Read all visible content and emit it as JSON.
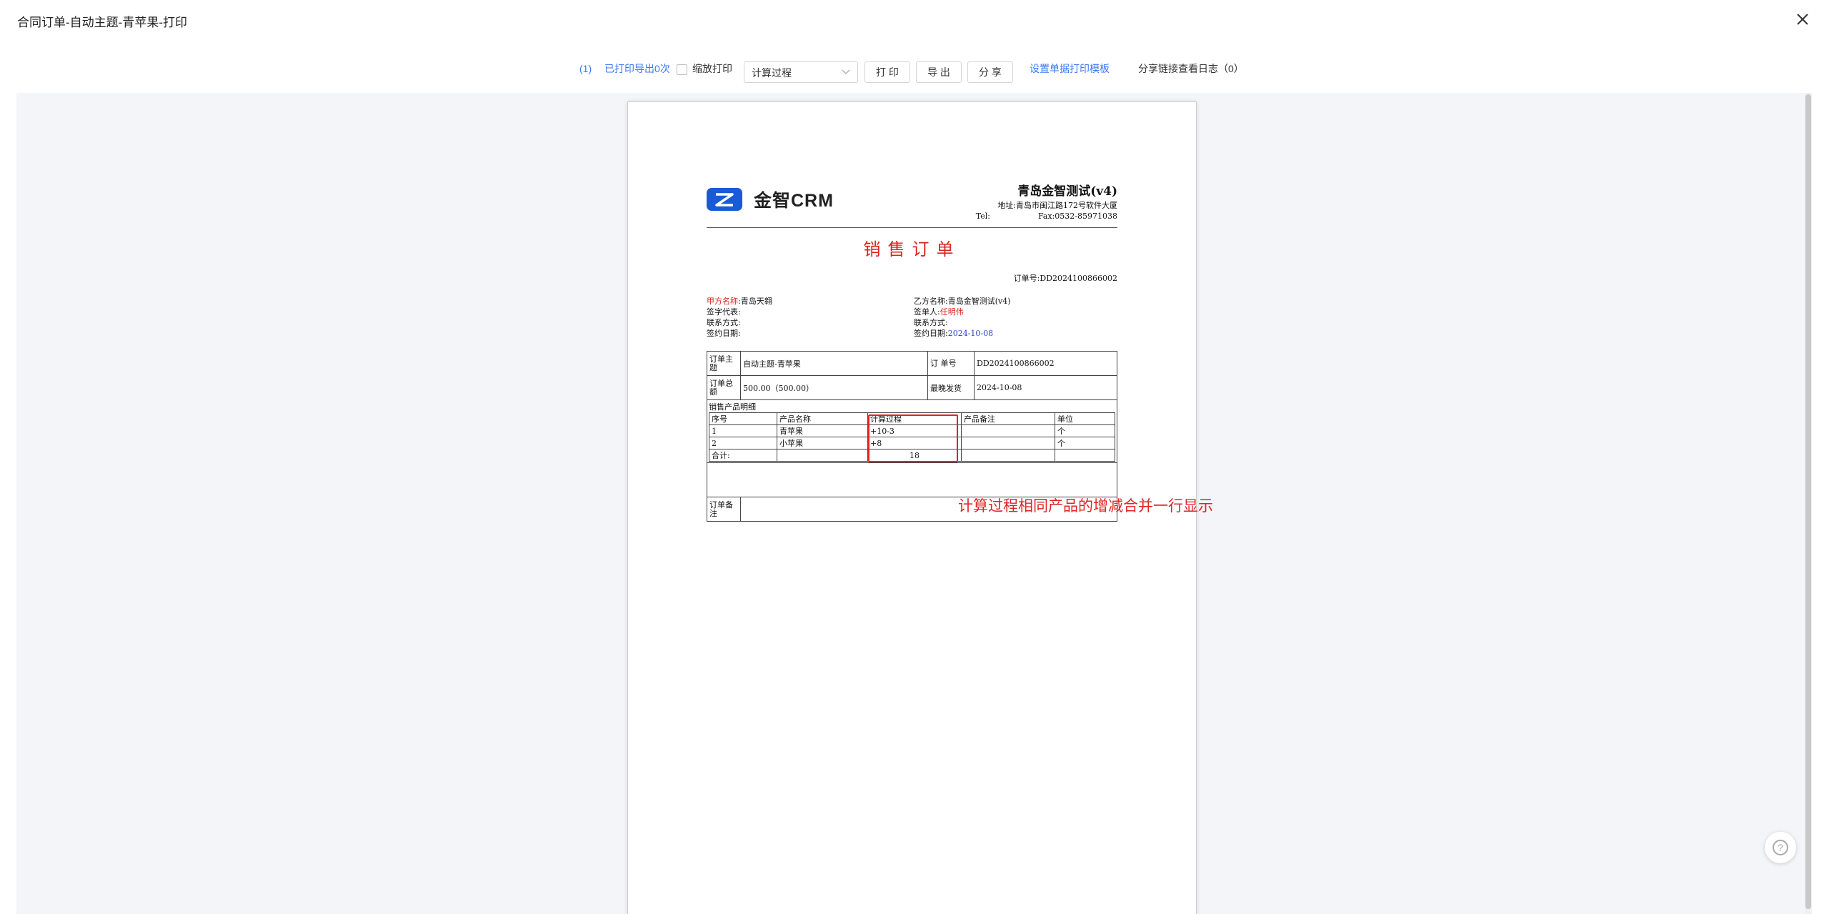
{
  "window": {
    "title": "合同订单-自动主题-青苹果-打印"
  },
  "toolbar": {
    "print_count_prefix": "(1)",
    "print_count_text": "已打印导出0次",
    "zoom_print_label": "缩放打印",
    "select_value": "计算过程",
    "print_label": "打 印",
    "export_label": "导 出",
    "share_label": "分 享",
    "template_link": "设置单据打印模板",
    "share_log_label": "分享链接查看日志（0）"
  },
  "document": {
    "logo_text": "金智CRM",
    "company_name": "青岛金智测试(v4)",
    "address": "地址:青岛市闽江路172号软件大厦",
    "tel_label": "Tel:",
    "fax": "Fax:0532-85971038",
    "title": "销售订单",
    "order_no": "订单号:DD2024100866002",
    "party_a": {
      "name_label": "甲方名称",
      "name_value": "青岛天翱",
      "rep_label": "签字代表:",
      "contact_label": "联系方式:",
      "date_label": "签约日期:"
    },
    "party_b": {
      "name_label": "乙方名称:",
      "name_value": "青岛金智测试(v4)",
      "signer_label": "签单人:",
      "signer_value": "任明伟",
      "contact_label": "联系方式:",
      "date_label": "签约日期:",
      "date_value": "2024-10-08"
    },
    "table": {
      "subject_label": "订单主题",
      "subject_value": "自动主题-青苹果",
      "order_label": "订 单号",
      "order_value": "DD2024100866002",
      "amount_label": "订单总额",
      "amount_value": "500.00（500.00）",
      "delivery_label": "最晚发货",
      "delivery_value": "2024-10-08",
      "items_label": "销售产品明细",
      "headers": [
        "序号",
        "产品名称",
        "计算过程",
        "产品备注",
        "单位"
      ],
      "rows": [
        [
          "1",
          "青苹果",
          "+10-3",
          "",
          "个"
        ],
        [
          "2",
          "小苹果",
          "+8",
          "",
          "个"
        ]
      ],
      "total_label": "合计:",
      "total_value": "18",
      "remarks_label": "订单备注"
    }
  },
  "annotation": {
    "text": "计算过程相同产品的增减合并一行显示",
    "color": "#e02424"
  },
  "colors": {
    "link": "#3a78f2",
    "accent_red": "#d9231c",
    "logo_blue": "#1a5ad8"
  }
}
